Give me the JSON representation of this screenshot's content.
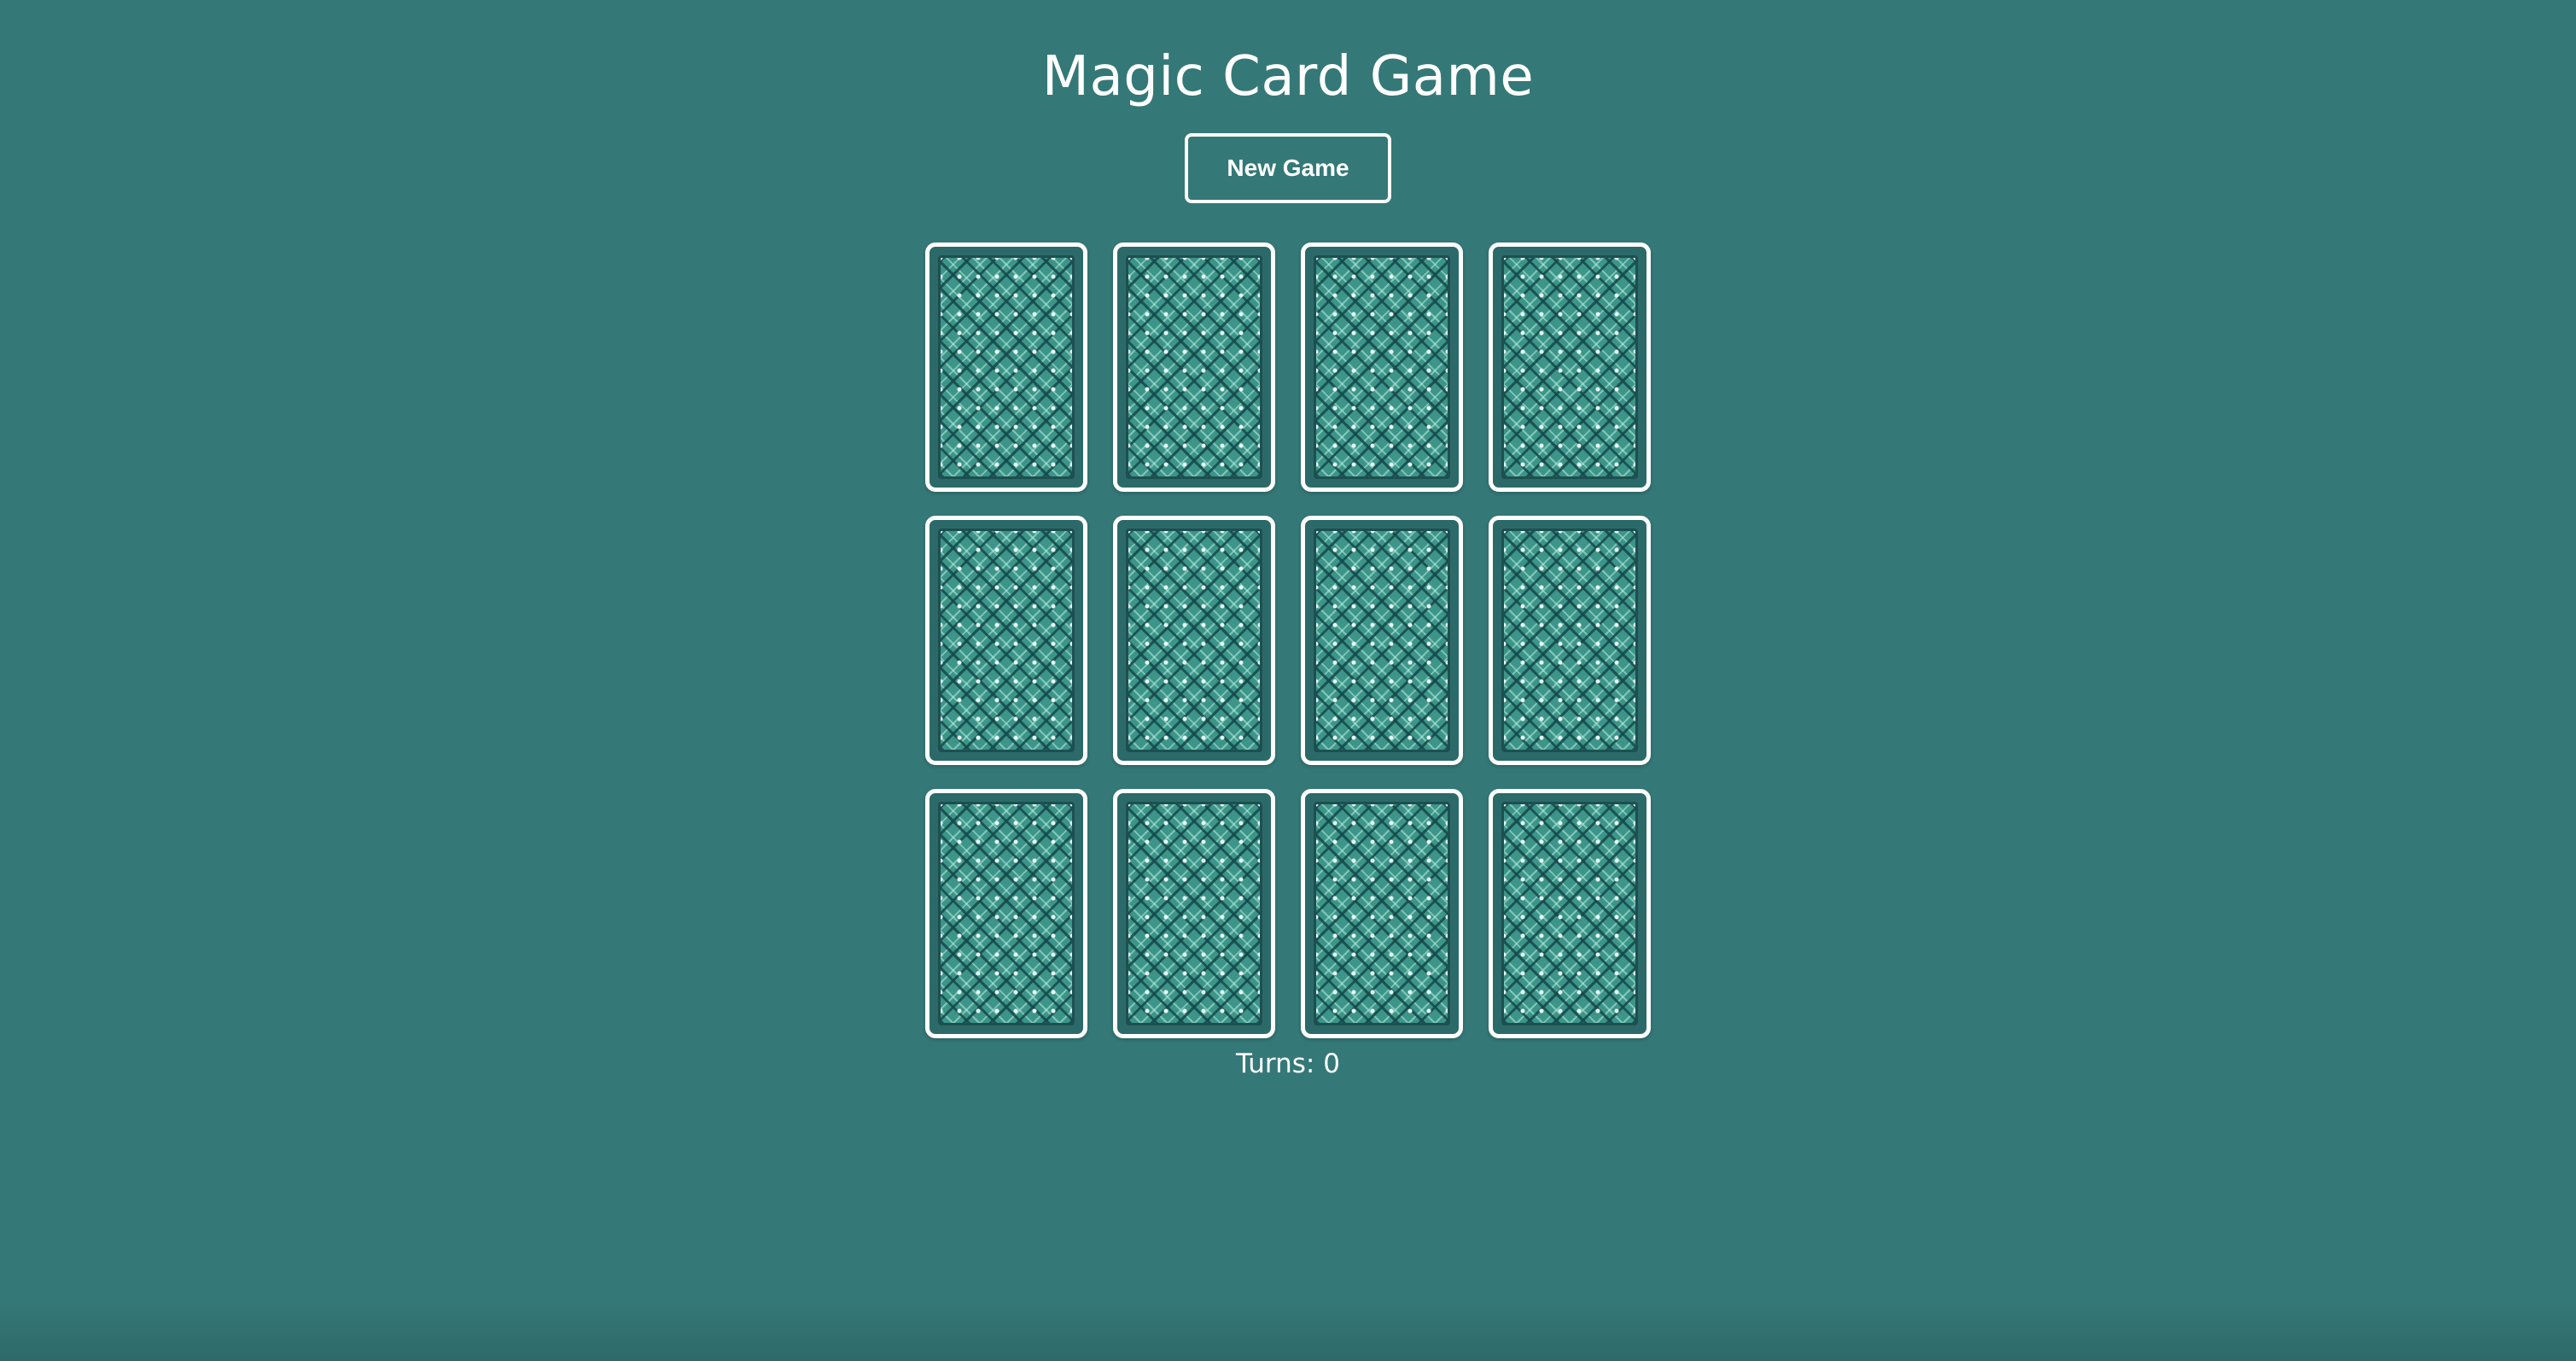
{
  "game": {
    "title": "Magic Card Game",
    "new_game_label": "New Game",
    "turns_label": "Turns:",
    "turns": 0
  },
  "board": {
    "rows": 3,
    "columns": 4,
    "cards": [
      {
        "state": "face-down"
      },
      {
        "state": "face-down"
      },
      {
        "state": "face-down"
      },
      {
        "state": "face-down"
      },
      {
        "state": "face-down"
      },
      {
        "state": "face-down"
      },
      {
        "state": "face-down"
      },
      {
        "state": "face-down"
      },
      {
        "state": "face-down"
      },
      {
        "state": "face-down"
      },
      {
        "state": "face-down"
      },
      {
        "state": "face-down"
      }
    ]
  },
  "colors": {
    "background": "#347877",
    "card_border": "#ffffff",
    "card_back": "#3d9488",
    "card_pattern_dark": "#1e4f50",
    "text": "#ffffff"
  }
}
